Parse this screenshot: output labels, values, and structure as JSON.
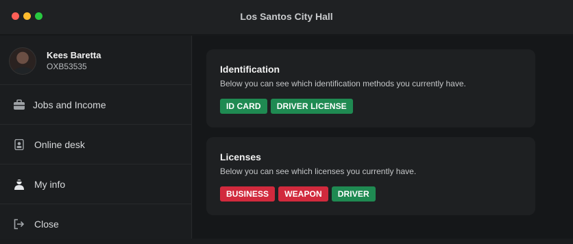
{
  "window": {
    "title": "Los Santos City Hall",
    "controls": {
      "close_color": "#ff5f57",
      "minimize_color": "#febc2e",
      "maximize_color": "#28c840"
    }
  },
  "profile": {
    "name": "Kees Baretta",
    "id": "OXB53535"
  },
  "sidebar": {
    "items": [
      {
        "label": "Jobs and Income",
        "icon": "briefcase-icon"
      },
      {
        "label": "Online desk",
        "icon": "desk-icon"
      },
      {
        "label": "My info",
        "icon": "user-icon"
      },
      {
        "label": "Close",
        "icon": "logout-icon"
      }
    ]
  },
  "identification": {
    "title": "Identification",
    "description": "Below you can see which identification methods you currently have.",
    "badges": [
      {
        "label": "ID CARD",
        "color": "green"
      },
      {
        "label": "DRIVER LICENSE",
        "color": "green"
      }
    ]
  },
  "licenses": {
    "title": "Licenses",
    "description": "Below you can see which licenses you currently have.",
    "badges": [
      {
        "label": "BUSINESS",
        "color": "red"
      },
      {
        "label": "WEAPON",
        "color": "red"
      },
      {
        "label": "DRIVER",
        "color": "green"
      }
    ]
  },
  "colors": {
    "badge_green": "#1f8a52",
    "badge_red": "#d12a3d"
  }
}
